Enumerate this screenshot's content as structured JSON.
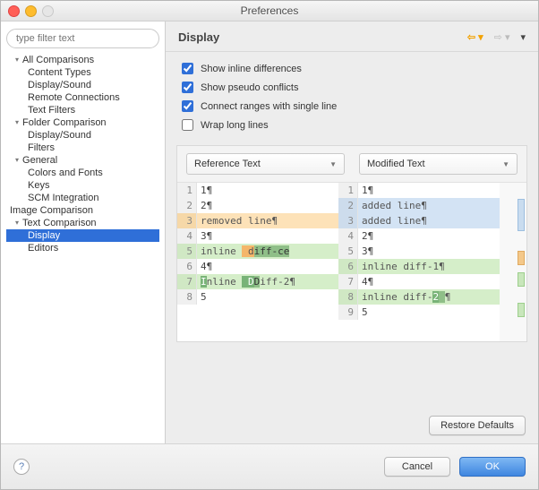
{
  "window": {
    "title": "Preferences"
  },
  "sidebar": {
    "filter_placeholder": "type filter text",
    "items": [
      {
        "label": "All Comparisons",
        "type": "group"
      },
      {
        "label": "Content Types",
        "type": "child"
      },
      {
        "label": "Display/Sound",
        "type": "child"
      },
      {
        "label": "Remote Connections",
        "type": "child"
      },
      {
        "label": "Text Filters",
        "type": "child"
      },
      {
        "label": "Folder Comparison",
        "type": "group"
      },
      {
        "label": "Display/Sound",
        "type": "child"
      },
      {
        "label": "Filters",
        "type": "child"
      },
      {
        "label": "General",
        "type": "group"
      },
      {
        "label": "Colors and Fonts",
        "type": "child"
      },
      {
        "label": "Keys",
        "type": "child"
      },
      {
        "label": "SCM Integration",
        "type": "child"
      },
      {
        "label": "Image Comparison",
        "type": "node"
      },
      {
        "label": "Text Comparison",
        "type": "group"
      },
      {
        "label": "Display",
        "type": "child",
        "selected": true
      },
      {
        "label": "Editors",
        "type": "child"
      }
    ]
  },
  "page": {
    "title": "Display",
    "checks": [
      {
        "label": "Show inline differences",
        "checked": true
      },
      {
        "label": "Show pseudo conflicts",
        "checked": true
      },
      {
        "label": "Connect ranges with single line",
        "checked": true
      },
      {
        "label": "Wrap long lines",
        "checked": false
      }
    ],
    "dropdowns": {
      "left": "Reference Text",
      "right": "Modified Text"
    },
    "left_lines": [
      {
        "n": "1",
        "t": "1¶"
      },
      {
        "n": "2",
        "t": "2¶"
      },
      {
        "n": "3",
        "t": "removed line¶",
        "kind": "removed"
      },
      {
        "n": "4",
        "t": "3¶"
      },
      {
        "n": "5",
        "t": "inline  diff-ce",
        "kind": "inline",
        "marks": [
          [
            7,
            2,
            "del"
          ],
          [
            9,
            7,
            "mark"
          ]
        ]
      },
      {
        "n": "6",
        "t": "4¶"
      },
      {
        "n": "7",
        "t": "Inline  Diff-2¶",
        "kind": "inline",
        "marks": [
          [
            0,
            1,
            "mark2"
          ],
          [
            7,
            2,
            "mark2"
          ],
          [
            8,
            1,
            "mark"
          ]
        ]
      },
      {
        "n": "8",
        "t": "5"
      }
    ],
    "right_lines": [
      {
        "n": "1",
        "t": "1¶"
      },
      {
        "n": "2",
        "t": "added line¶",
        "kind": "added"
      },
      {
        "n": "3",
        "t": "added line¶",
        "kind": "added"
      },
      {
        "n": "4",
        "t": "2¶"
      },
      {
        "n": "5",
        "t": "3¶"
      },
      {
        "n": "6",
        "t": "inline diff-1¶",
        "kind": "inline"
      },
      {
        "n": "7",
        "t": "4¶"
      },
      {
        "n": "8",
        "t": "inline diff-2 ¶",
        "kind": "inline",
        "marks": [
          [
            12,
            1,
            "mark2"
          ],
          [
            13,
            1,
            "mark"
          ]
        ]
      },
      {
        "n": "9",
        "t": "5"
      }
    ]
  },
  "buttons": {
    "restore": "Restore Defaults",
    "cancel": "Cancel",
    "ok": "OK"
  }
}
